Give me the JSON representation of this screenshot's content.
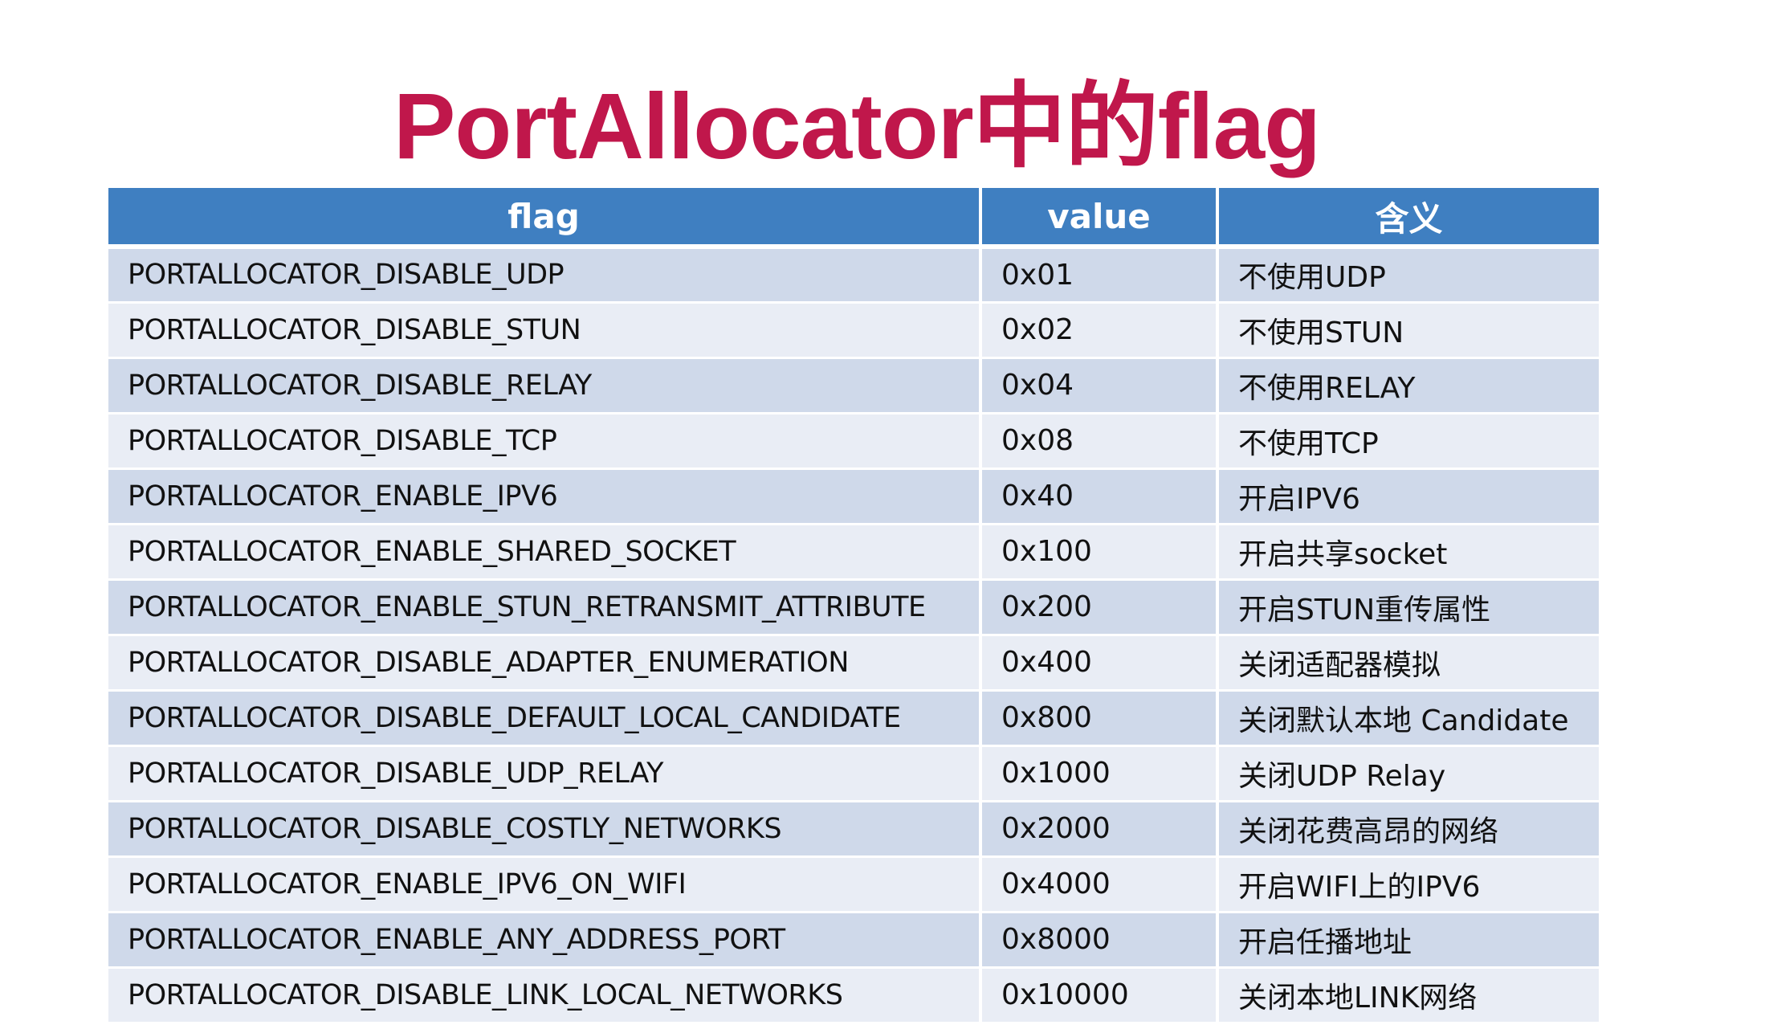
{
  "title": "PortAllocator中的flag",
  "table": {
    "headers": [
      "flag",
      "value",
      "含义"
    ],
    "rows": [
      {
        "flag": "PORTALLOCATOR_DISABLE_UDP",
        "value": "0x01",
        "meaning": "不使用UDP"
      },
      {
        "flag": "PORTALLOCATOR_DISABLE_STUN",
        "value": "0x02",
        "meaning": "不使用STUN"
      },
      {
        "flag": "PORTALLOCATOR_DISABLE_RELAY",
        "value": "0x04",
        "meaning": "不使用RELAY"
      },
      {
        "flag": "PORTALLOCATOR_DISABLE_TCP",
        "value": "0x08",
        "meaning": "不使用TCP"
      },
      {
        "flag": "PORTALLOCATOR_ENABLE_IPV6",
        "value": "0x40",
        "meaning": "开启IPV6"
      },
      {
        "flag": "PORTALLOCATOR_ENABLE_SHARED_SOCKET",
        "value": "0x100",
        "meaning": "开启共享socket"
      },
      {
        "flag": "PORTALLOCATOR_ENABLE_STUN_RETRANSMIT_ATTRIBUTE",
        "value": "0x200",
        "meaning": "开启STUN重传属性"
      },
      {
        "flag": "PORTALLOCATOR_DISABLE_ADAPTER_ENUMERATION",
        "value": "0x400",
        "meaning": "关闭适配器模拟"
      },
      {
        "flag": "PORTALLOCATOR_DISABLE_DEFAULT_LOCAL_CANDIDATE",
        "value": "0x800",
        "meaning": "关闭默认本地 Candidate"
      },
      {
        "flag": "PORTALLOCATOR_DISABLE_UDP_RELAY",
        "value": "0x1000",
        "meaning": "关闭UDP Relay"
      },
      {
        "flag": "PORTALLOCATOR_DISABLE_COSTLY_NETWORKS",
        "value": "0x2000",
        "meaning": "关闭花费高昂的网络"
      },
      {
        "flag": "PORTALLOCATOR_ENABLE_IPV6_ON_WIFI",
        "value": "0x4000",
        "meaning": "开启WIFI上的IPV6"
      },
      {
        "flag": "PORTALLOCATOR_ENABLE_ANY_ADDRESS_PORT",
        "value": "0x8000",
        "meaning": "开启任播地址"
      },
      {
        "flag": "PORTALLOCATOR_DISABLE_LINK_LOCAL_NETWORKS",
        "value": "0x10000",
        "meaning": "关闭本地LINK网络"
      }
    ]
  },
  "colors": {
    "title": "#c0174b",
    "header_bg": "#3f7fc1",
    "row_dark": "#cfd9ea",
    "row_light": "#e9edf5"
  }
}
